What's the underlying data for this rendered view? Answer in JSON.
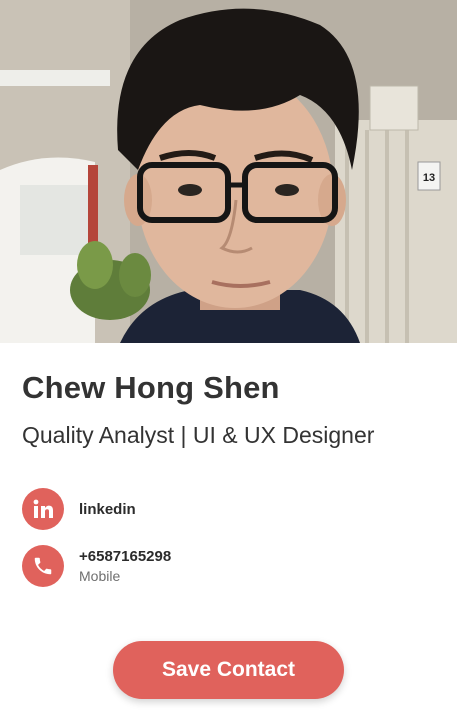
{
  "profile": {
    "name": "Chew Hong Shen",
    "title": "Quality Analyst | UI & UX Designer",
    "photo_alt": "Chew Hong Shen"
  },
  "contacts": {
    "linkedin": {
      "label": "linkedin",
      "icon": "linkedin-icon"
    },
    "phone": {
      "number": "+6587165298",
      "type": "Mobile",
      "icon": "phone-icon"
    }
  },
  "actions": {
    "save_label": "Save Contact"
  },
  "colors": {
    "accent": "#e0625c",
    "text": "#333333",
    "muted": "#6f6f6f"
  }
}
